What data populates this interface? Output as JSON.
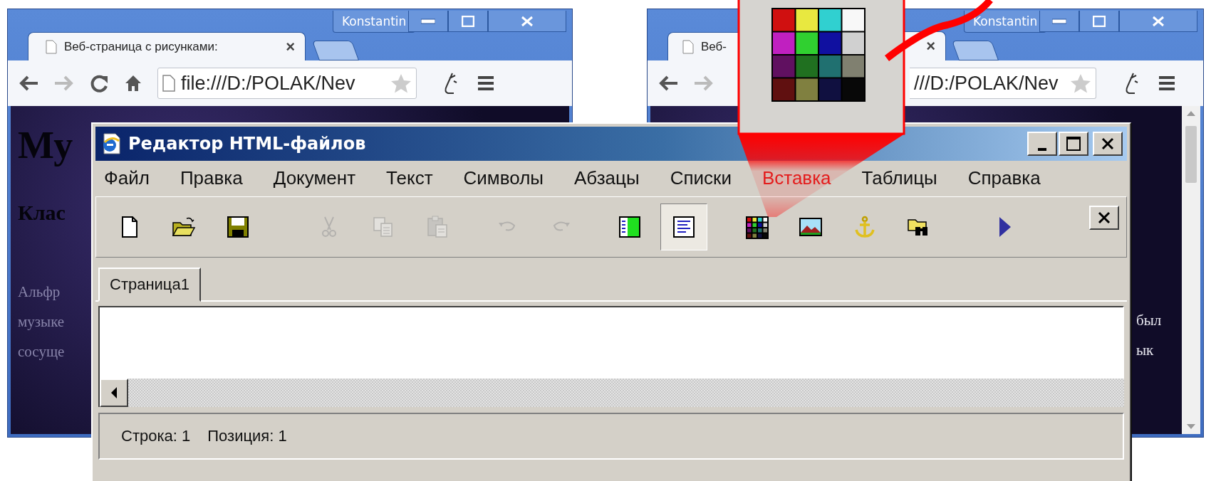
{
  "browsers": [
    {
      "user": "Konstantin",
      "tab_title": "Веб-страница с рисунками:",
      "tab_close": "×",
      "address": "file:///D:/POLAK/Nev",
      "page_texts": [
        {
          "kind": "heading",
          "text": "Му"
        },
        {
          "kind": "subheading",
          "text": "Клас"
        },
        {
          "kind": "body",
          "text": "Альфр"
        },
        {
          "kind": "body",
          "text": "музыке"
        },
        {
          "kind": "body",
          "text": "сосуще"
        }
      ]
    },
    {
      "user": "Konstantin",
      "tab_title": "Веб-",
      "tab_close": "×",
      "address": "///D:/POLAK/Nev",
      "page_texts": [
        {
          "kind": "body",
          "text": "был"
        },
        {
          "kind": "body",
          "text": "ык"
        }
      ]
    }
  ],
  "editor": {
    "title": "Редактор HTML-файлов",
    "menu": [
      {
        "label": "Файл",
        "selected": false
      },
      {
        "label": "Правка",
        "selected": false
      },
      {
        "label": "Документ",
        "selected": false
      },
      {
        "label": "Текст",
        "selected": false
      },
      {
        "label": "Символы",
        "selected": false
      },
      {
        "label": "Абзацы",
        "selected": false
      },
      {
        "label": "Списки",
        "selected": false
      },
      {
        "label": "Вставка",
        "selected": true
      },
      {
        "label": "Таблицы",
        "selected": false
      },
      {
        "label": "Справка",
        "selected": false
      }
    ],
    "toolbar_groups": [
      [
        {
          "kind": "new",
          "disabled": false,
          "pressed": false
        },
        {
          "kind": "open",
          "disabled": false,
          "pressed": false
        },
        {
          "kind": "save",
          "disabled": false,
          "pressed": false
        }
      ],
      [
        {
          "kind": "cut",
          "disabled": true,
          "pressed": false
        },
        {
          "kind": "copy",
          "disabled": true,
          "pressed": false
        },
        {
          "kind": "paste",
          "disabled": true,
          "pressed": false
        }
      ],
      [
        {
          "kind": "undo",
          "disabled": true,
          "pressed": false
        },
        {
          "kind": "redo",
          "disabled": true,
          "pressed": false
        }
      ],
      [
        {
          "kind": "split",
          "disabled": false,
          "pressed": false
        },
        {
          "kind": "text",
          "disabled": false,
          "pressed": true
        }
      ],
      [
        {
          "kind": "colors",
          "disabled": false,
          "pressed": false
        },
        {
          "kind": "picture",
          "disabled": false,
          "pressed": false
        },
        {
          "kind": "anchor",
          "disabled": false,
          "pressed": false
        },
        {
          "kind": "find",
          "disabled": false,
          "pressed": false
        }
      ],
      [
        {
          "kind": "run",
          "disabled": false,
          "pressed": false
        }
      ]
    ],
    "tabs": [
      {
        "label": "Страница1",
        "selected": true
      }
    ],
    "status": [
      "Строка: 1",
      "Позиция: 1"
    ]
  }
}
